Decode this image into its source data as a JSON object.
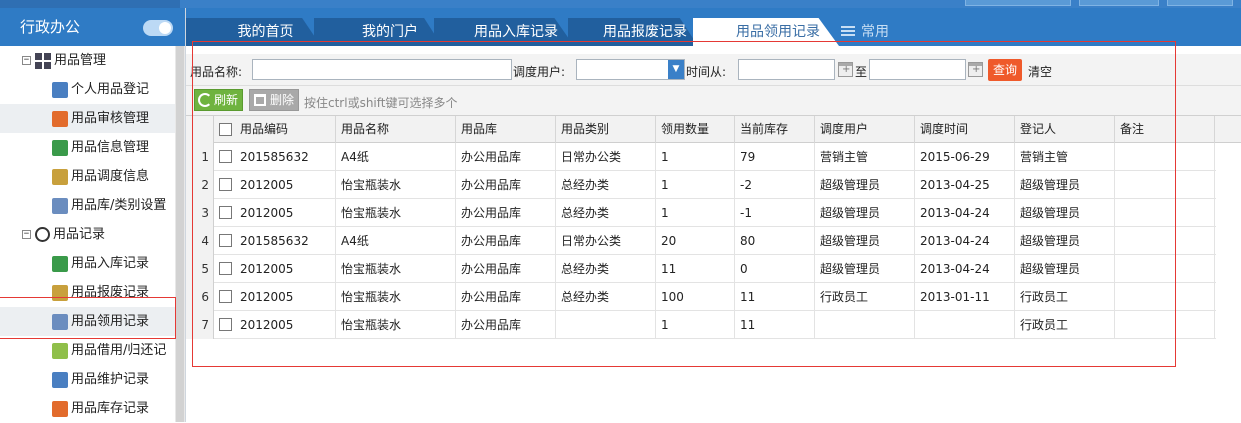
{
  "app": {
    "title": "行政办公"
  },
  "colors": {
    "primary": "#2f7bc5",
    "accent_red": "#ef5a2b",
    "refresh_green": "#6fb33f",
    "selection_red": "#e53935"
  },
  "sidebar": {
    "groups": [
      {
        "label": "用品管理",
        "icon": "grid-icon",
        "items": [
          {
            "label": "个人用品登记",
            "icon": "user-edit-icon"
          },
          {
            "label": "用品审核管理",
            "icon": "user-check-icon"
          },
          {
            "label": "用品信息管理",
            "icon": "info-card-icon"
          },
          {
            "label": "用品调度信息",
            "icon": "dispatch-icon"
          },
          {
            "label": "用品库/类别设置",
            "icon": "settings-blocks-icon"
          }
        ]
      },
      {
        "label": "用品记录",
        "icon": "clock-icon",
        "items": [
          {
            "label": "用品入库记录",
            "icon": "inbox-icon"
          },
          {
            "label": "用品报废记录",
            "icon": "no-entry-icon"
          },
          {
            "label": "用品领用记录",
            "icon": "receive-icon"
          },
          {
            "label": "用品借用/归还记",
            "icon": "borrow-icon"
          },
          {
            "label": "用品维护记录",
            "icon": "refresh-icon"
          },
          {
            "label": "用品库存记录",
            "icon": "inventory-icon"
          }
        ]
      }
    ]
  },
  "tabs": [
    {
      "label": "我的首页"
    },
    {
      "label": "我的门户"
    },
    {
      "label": "用品入库记录"
    },
    {
      "label": "用品报废记录"
    },
    {
      "label": "用品领用记录"
    }
  ],
  "tab_common": {
    "label": "常用"
  },
  "search": {
    "name_label": "用品名称:",
    "name_value": "",
    "user_label": "调度用户:",
    "user_value": "",
    "time_from_label": "时间从:",
    "time_from_value": "",
    "to_label": "至",
    "time_to_value": "",
    "query_label": "查询",
    "clear_label": "清空"
  },
  "toolbar": {
    "refresh_label": "刷新",
    "delete_label": "删除",
    "hint": "按住ctrl或shift键可选择多个"
  },
  "grid": {
    "columns": [
      "用品编码",
      "用品名称",
      "用品库",
      "用品类别",
      "领用数量",
      "当前库存",
      "调度用户",
      "调度时间",
      "登记人",
      "备注"
    ],
    "rows": [
      {
        "num": "1",
        "cells": [
          "201585632",
          "A4纸",
          "办公用品库",
          "日常办公类",
          "1",
          "79",
          "营销主管",
          "2015-06-29",
          "营销主管",
          ""
        ]
      },
      {
        "num": "2",
        "cells": [
          "2012005",
          "怡宝瓶装水",
          "办公用品库",
          "总经办类",
          "1",
          "-2",
          "超级管理员",
          "2013-04-25",
          "超级管理员",
          ""
        ]
      },
      {
        "num": "3",
        "cells": [
          "2012005",
          "怡宝瓶装水",
          "办公用品库",
          "总经办类",
          "1",
          "-1",
          "超级管理员",
          "2013-04-24",
          "超级管理员",
          ""
        ]
      },
      {
        "num": "4",
        "cells": [
          "201585632",
          "A4纸",
          "办公用品库",
          "日常办公类",
          "20",
          "80",
          "超级管理员",
          "2013-04-24",
          "超级管理员",
          ""
        ]
      },
      {
        "num": "5",
        "cells": [
          "2012005",
          "怡宝瓶装水",
          "办公用品库",
          "总经办类",
          "11",
          "0",
          "超级管理员",
          "2013-04-24",
          "超级管理员",
          ""
        ]
      },
      {
        "num": "6",
        "cells": [
          "2012005",
          "怡宝瓶装水",
          "办公用品库",
          "总经办类",
          "100",
          "11",
          "行政员工",
          "2013-01-11",
          "行政员工",
          ""
        ]
      },
      {
        "num": "7",
        "cells": [
          "2012005",
          "怡宝瓶装水",
          "办公用品库",
          "",
          "1",
          "11",
          "",
          "",
          "行政员工",
          ""
        ]
      }
    ]
  }
}
